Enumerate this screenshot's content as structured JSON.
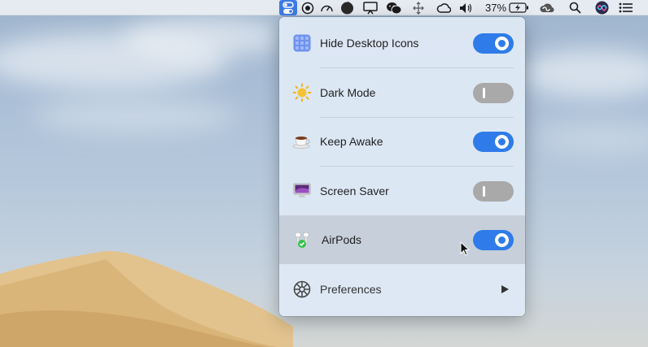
{
  "menubar": {
    "battery_percent": "37%",
    "icons": [
      "one-switch-icon",
      "record-icon",
      "speedometer-icon",
      "apple-logo-icon",
      "display-icon",
      "wechat-icon",
      "move-icon",
      "creative-cloud-icon",
      "volume-icon",
      "battery-charging-icon",
      "creative-cloud-alt-icon",
      "search-icon",
      "siri-icon",
      "notification-center-icon"
    ]
  },
  "panel": {
    "items": [
      {
        "label": "Hide Desktop Icons",
        "icon": "desktop-grid-icon",
        "toggle": "on"
      },
      {
        "label": "Dark Mode",
        "icon": "sun-icon",
        "toggle": "off"
      },
      {
        "label": "Keep Awake",
        "icon": "coffee-cup-icon",
        "toggle": "on"
      },
      {
        "label": "Screen Saver",
        "icon": "monitor-icon",
        "toggle": "off"
      },
      {
        "label": "AirPods",
        "icon": "airpods-icon",
        "toggle": "on",
        "highlighted": true
      },
      {
        "label": "Preferences",
        "icon": "gear-icon",
        "submenu": true
      }
    ]
  },
  "colors": {
    "accent": "#2f7bea",
    "toggle_off": "#a9a9a9",
    "menubar_active": "#3d7ce8"
  }
}
